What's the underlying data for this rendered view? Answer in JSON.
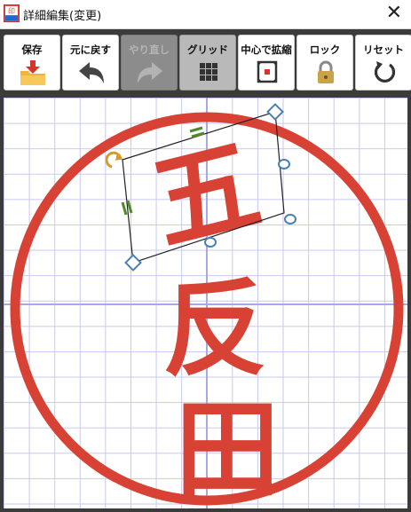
{
  "window": {
    "title": "詳細編集(変更)",
    "close_glyph": "✕",
    "app_icon": "stamp-app-icon"
  },
  "toolbar": {
    "save_label": "保存",
    "undo_label": "元に戻す",
    "redo_label": "やり直し",
    "grid_label": "グリッド",
    "center_zoom_label": "中心で拡縮",
    "lock_label": "ロック",
    "reset_label": "リセット",
    "redo_enabled": false,
    "grid_active": true
  },
  "stamp": {
    "chars": [
      "五",
      "反",
      "田"
    ],
    "ring_color": "#d84235",
    "grid_color": "#c8c8f0",
    "axis_color": "#a8a8e8"
  },
  "colors": {
    "toolbar_bg": "#3b3b3b",
    "accent_red": "#d84235",
    "handle_blue": "#4a7fb0",
    "handle_green": "#4f8a2a",
    "handle_orange": "#d89a2a"
  }
}
